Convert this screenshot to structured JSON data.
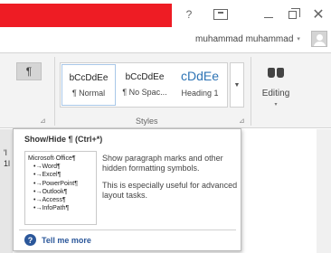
{
  "titlebar": {
    "brand_color": "#ee1c24",
    "help_label": "?",
    "ribbon_options_icon": "ribbon-display-options-icon",
    "close_label": "✕",
    "user_name": "muhammad muhammad",
    "account_caret": "▾"
  },
  "ribbon": {
    "paragraph": {
      "show_hide_glyph": "¶",
      "launcher_glyph": "⊿"
    },
    "styles": {
      "items": [
        {
          "preview": "bCcDdEe",
          "name": "¶ Normal"
        },
        {
          "preview": "bCcDdEe",
          "name": "¶ No Spac..."
        },
        {
          "preview": "cDdEe",
          "name": "Heading 1"
        }
      ],
      "more_glyph": "▼",
      "group_label": "Styles",
      "launcher_glyph": "⊿",
      "heading_color": "#2e74b5"
    },
    "editing": {
      "label": "Editing",
      "caret": "▾",
      "icon": "binoculars-icon"
    }
  },
  "document": {
    "lines": [
      "'l",
      "1l"
    ]
  },
  "tooltip": {
    "title": "Show/Hide ¶ (Ctrl+*)",
    "description_1": "Show paragraph marks and other hidden formatting symbols.",
    "description_2": "This is especially useful for advanced layout tasks.",
    "preview": {
      "heading": "Microsoft·Office¶",
      "items": [
        "Word¶",
        "Excel¶",
        "PowerPoint¶",
        "Outlook¶",
        "Access¶",
        "InfoPath¶"
      ],
      "bullet": "•→"
    },
    "help_icon_glyph": "?",
    "tell_me_more": "Tell me more",
    "accent_color": "#2b579a"
  }
}
